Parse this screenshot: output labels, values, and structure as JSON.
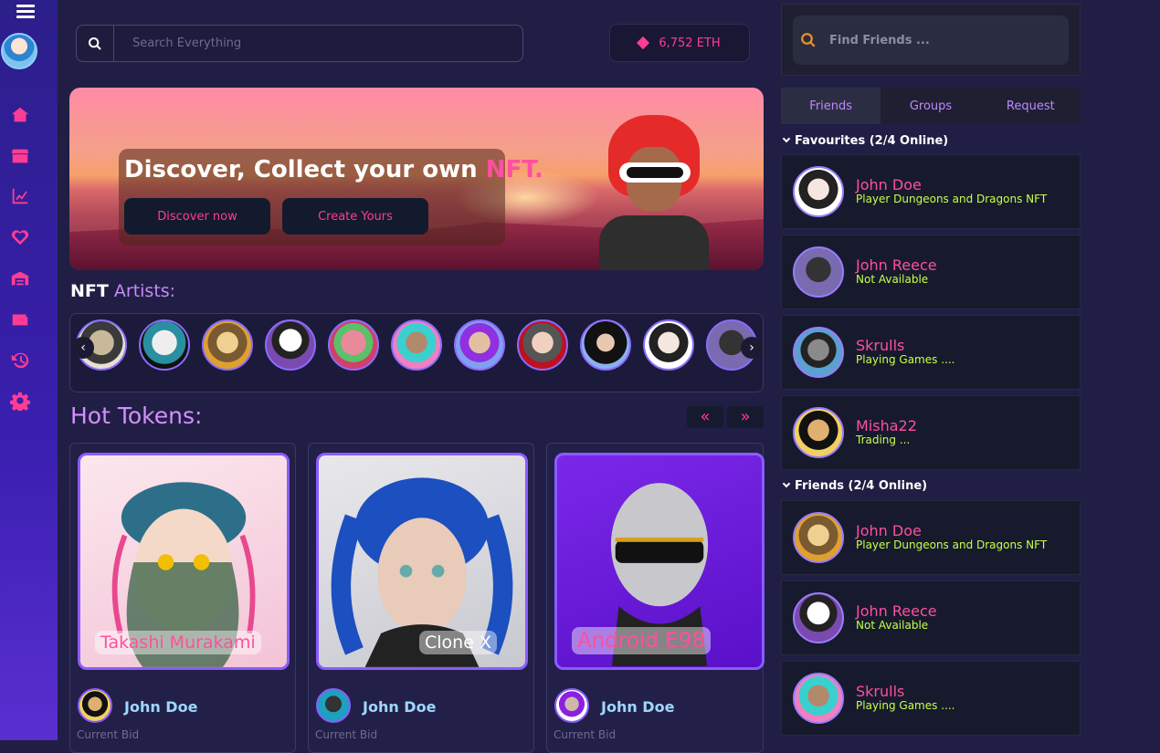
{
  "search": {
    "placeholder": "Search Everything"
  },
  "balance": {
    "value": "6,752 ETH"
  },
  "banner": {
    "title_main": "Discover, Collect your own ",
    "title_accent": "NFT.",
    "discover_label": "Discover now",
    "create_label": "Create Yours"
  },
  "artists": {
    "title_main": "NFT",
    "title_accent": " Artists:"
  },
  "hot": {
    "title": "Hot Tokens:",
    "prev_label": "«",
    "next_label": "»",
    "tokens": [
      {
        "name": "Takashi Murakami",
        "owner": "John Doe",
        "bid_label": "Current Bid"
      },
      {
        "name": "Clone X",
        "owner": "John Doe",
        "bid_label": "Current Bid"
      },
      {
        "name": "Android E98",
        "owner": "John Doe",
        "bid_label": "Current Bid"
      }
    ]
  },
  "friends_panel": {
    "search_placeholder": "Find Friends ...",
    "tabs": [
      "Friends",
      "Groups",
      "Request"
    ],
    "favourites_title": "Favourites (2/4 Online)",
    "friends_title": "Friends (2/4 Online)",
    "favourites": [
      {
        "name": "John Doe",
        "status": "Player Dungeons and Dragons NFT"
      },
      {
        "name": "John Reece",
        "status": "Not Available"
      },
      {
        "name": "Skrulls",
        "status": "Playing Games ...."
      },
      {
        "name": "Misha22",
        "status": "Trading ..."
      }
    ],
    "friends": [
      {
        "name": "John Doe",
        "status": "Player Dungeons and Dragons NFT"
      },
      {
        "name": "John Reece",
        "status": "Not Available"
      },
      {
        "name": "Skrulls",
        "status": "Playing Games ...."
      }
    ]
  },
  "colors": {
    "accent": "#ff3c93",
    "purple": "#c58af9",
    "status": "#c8ff4a"
  }
}
